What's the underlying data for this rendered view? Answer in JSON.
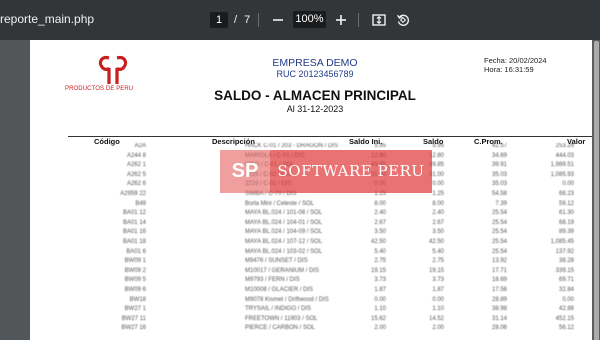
{
  "toolbar": {
    "title": "reporte_main.php",
    "current_page": "1",
    "page_separator": "/",
    "total_pages": "7",
    "zoom": "100%",
    "zoom_out_icon": "minus-icon",
    "zoom_in_icon": "plus-icon",
    "fit_icon": "fit-to-page-icon",
    "rotate_icon": "rotate-icon"
  },
  "header": {
    "logo_text": "PRODUCTOS DE PERU",
    "company_name": "EMPRESA DEMO",
    "ruc": "RUC 20123456789",
    "date": "Fecha: 20/02/2024",
    "time": "Hora: 16:31:59",
    "title": "SALDO - ALMACEN PRINCIPAL",
    "subtitle": "Al 31-12-2023"
  },
  "table": {
    "headers": {
      "code": "Código",
      "description": "Descripción",
      "saldo_ini": "Saldo Ini.",
      "saldo": "Saldo",
      "cprom": "C.Prom.",
      "valor": "Valor"
    },
    "rows": [
      {
        "code": "A2A",
        "desc": "HACK C-01 / 203 - DRAGON / DIS",
        "ini": "5.95",
        "saldo": "5.95",
        "prom": "42.57",
        "val": "253.29"
      },
      {
        "code": "A244 8",
        "desc": "MARIOLA / C-01 / DIS",
        "ini": "12.80",
        "saldo": "12.80",
        "prom": "34.69",
        "val": "444.03"
      },
      {
        "code": "A262 1",
        "desc": "KIBO / C-01 / SOL",
        "ini": "49.85",
        "saldo": "49.85",
        "prom": "39.91",
        "val": "1,989.51"
      },
      {
        "code": "A262 5",
        "desc": "2215 / C-02 / DIS",
        "ini": "31.00",
        "saldo": "31.00",
        "prom": "35.03",
        "val": "1,085.93"
      },
      {
        "code": "A262 6",
        "desc": "2219 / C-02 / DIS",
        "ini": "0.00",
        "saldo": "0.00",
        "prom": "35.03",
        "val": "0.00"
      },
      {
        "code": "A2959 22",
        "desc": "SIMBA / C-70 / DIS",
        "ini": "1.25",
        "saldo": "1.25",
        "prom": "54.58",
        "val": "68.23"
      },
      {
        "code": "B49",
        "desc": "Borla Mini / Celeste / SOL",
        "ini": "8.00",
        "saldo": "8.00",
        "prom": "7.39",
        "val": "59.12"
      },
      {
        "code": "BA01 12",
        "desc": "MAYA BL.024 / 101-08 / SOL",
        "ini": "2.40",
        "saldo": "2.40",
        "prom": "25.54",
        "val": "61.30"
      },
      {
        "code": "BA01 14",
        "desc": "MAYA BL.024 / 104-01 / SOL",
        "ini": "2.67",
        "saldo": "2.67",
        "prom": "25.54",
        "val": "68.19"
      },
      {
        "code": "BA01 16",
        "desc": "MAYA BL.024 / 104-09 / SOL",
        "ini": "3.50",
        "saldo": "3.50",
        "prom": "25.54",
        "val": "89.39"
      },
      {
        "code": "BA01 18",
        "desc": "MAYA BL.024 / 107-12 / SOL",
        "ini": "42.50",
        "saldo": "42.50",
        "prom": "25.54",
        "val": "1,085.45"
      },
      {
        "code": "BA01 6",
        "desc": "MAYA BL.024 / 103-02 / SOL",
        "ini": "5.40",
        "saldo": "5.40",
        "prom": "25.54",
        "val": "137.92"
      },
      {
        "code": "BW09 1",
        "desc": "M9476 / SUNSET / DIS",
        "ini": "2.75",
        "saldo": "2.75",
        "prom": "13.92",
        "val": "38.28"
      },
      {
        "code": "BW09 2",
        "desc": "M10017 / GERANIUM / DIS",
        "ini": "19.15",
        "saldo": "19.15",
        "prom": "17.71",
        "val": "339.15"
      },
      {
        "code": "BW09 5",
        "desc": "M9793 / FERN / DIS",
        "ini": "3.73",
        "saldo": "3.73",
        "prom": "18.69",
        "val": "69.71"
      },
      {
        "code": "BW09 6",
        "desc": "M10008 / GLACIER / DIS",
        "ini": "1.87",
        "saldo": "1.87",
        "prom": "17.56",
        "val": "32.84"
      },
      {
        "code": "BW18",
        "desc": "M9078 Kismet / Driftwood / DIS",
        "ini": "0.00",
        "saldo": "0.00",
        "prom": "28.89",
        "val": "0.00"
      },
      {
        "code": "BW27 1",
        "desc": "TRYSAIL / INDIGO / DIS",
        "ini": "1.10",
        "saldo": "1.10",
        "prom": "38.98",
        "val": "42.88"
      },
      {
        "code": "BW27 11",
        "desc": "FREETOWN / 11903 / SOL",
        "ini": "15.62",
        "saldo": "14.52",
        "prom": "31.14",
        "val": "452.15"
      },
      {
        "code": "BW27 16",
        "desc": "PIERCE / CARBON / SOL",
        "ini": "2.00",
        "saldo": "2.00",
        "prom": "28.06",
        "val": "56.12"
      }
    ]
  },
  "watermark": {
    "badge": "SP",
    "text": "SOFTWARE PERU"
  },
  "colors": {
    "toolbar_bg": "#323639",
    "viewer_bg": "#525659",
    "company_blue": "#233a8a",
    "logo_red": "#c81e1e",
    "watermark_red": "#e13c3c"
  }
}
